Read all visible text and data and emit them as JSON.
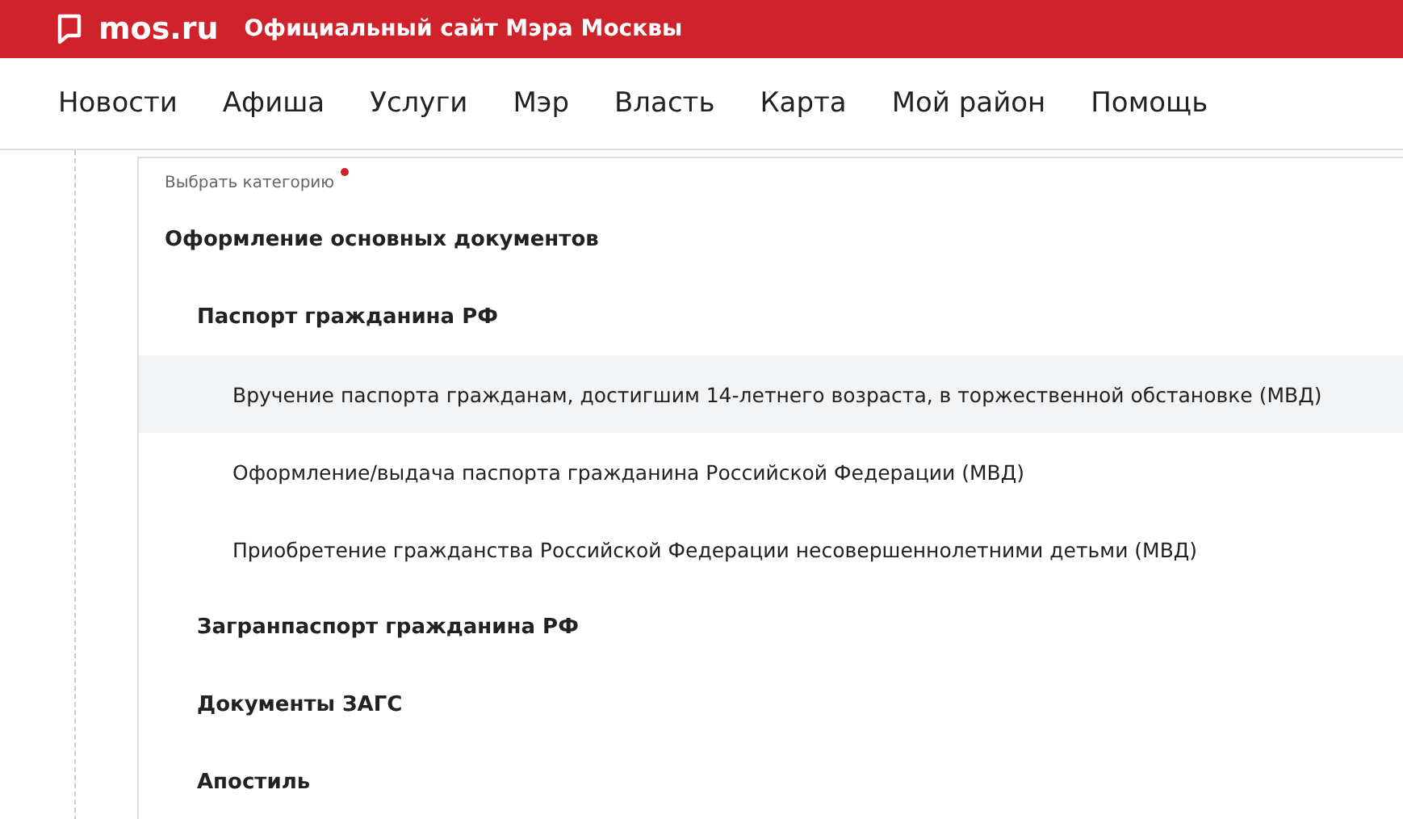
{
  "header": {
    "logo": "mos.ru",
    "title": "Официальный сайт Мэра Москвы"
  },
  "nav": [
    "Новости",
    "Афиша",
    "Услуги",
    "Мэр",
    "Власть",
    "Карта",
    "Мой район",
    "Помощь"
  ],
  "category_select": {
    "label": "Выбрать категорию",
    "required": true,
    "options": [
      {
        "label": "Оформление основных документов",
        "selected": false,
        "children": [
          {
            "label": "Паспорт гражданина РФ",
            "selected": false,
            "children": [
              {
                "label": "Вручение паспорта гражданам, достигшим 14-летнего возраста, в торжественной обстановке (МВД)",
                "selected": true
              },
              {
                "label": "Оформление/выдача паспорта гражданина Российской Федерации (МВД)",
                "selected": false
              },
              {
                "label": "Приобретение гражданства Российской Федерации несовершеннолетними детьми (МВД)",
                "selected": false
              }
            ]
          },
          {
            "label": "Загранпаспорт гражданина РФ",
            "selected": false
          },
          {
            "label": "Документы ЗАГС",
            "selected": false
          },
          {
            "label": "Апостиль",
            "selected": false
          }
        ]
      }
    ]
  }
}
